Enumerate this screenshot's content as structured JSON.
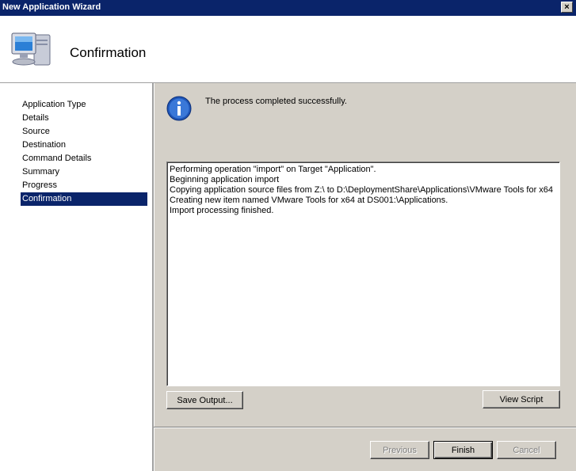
{
  "window": {
    "title": "New Application Wizard",
    "close_glyph": "×"
  },
  "header": {
    "title": "Confirmation",
    "icon": "computer-icon"
  },
  "sidebar": {
    "items": [
      {
        "label": "Application Type"
      },
      {
        "label": "Details"
      },
      {
        "label": "Source"
      },
      {
        "label": "Destination"
      },
      {
        "label": "Command Details"
      },
      {
        "label": "Summary"
      },
      {
        "label": "Progress"
      },
      {
        "label": "Confirmation"
      }
    ],
    "selected_index": 7
  },
  "main": {
    "status_icon": "info-icon",
    "status_text": "The process completed successfully.",
    "output_lines": [
      "Performing operation \"import\" on Target \"Application\".",
      "Beginning application import",
      "Copying application source files from Z:\\ to D:\\DeploymentShare\\Applications\\VMware Tools for x64",
      "Creating new item named VMware Tools for x64 at DS001:\\Applications.",
      "Import processing finished."
    ],
    "save_output_label": "Save Output...",
    "view_script_label": "View Script"
  },
  "footer": {
    "previous_label": "Previous",
    "finish_label": "Finish",
    "cancel_label": "Cancel"
  },
  "colors": {
    "titlebar": "#0a246a",
    "selection": "#0a246a",
    "face": "#d4d0c8"
  }
}
